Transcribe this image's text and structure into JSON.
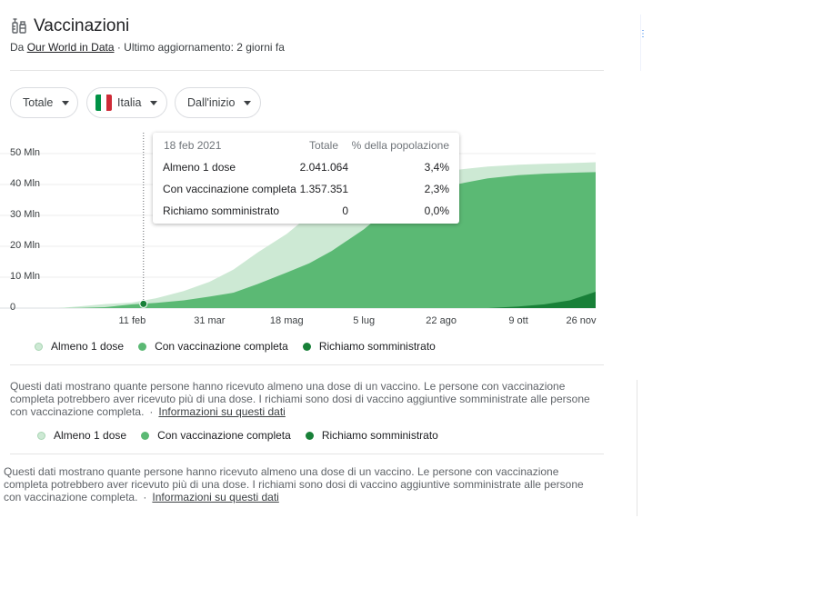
{
  "header": {
    "title": "Vaccinazioni",
    "source_prefix": "Da",
    "source_link": "Our World in Data",
    "source_suffix": "· Ultimo aggiornamento: 2 giorni fa"
  },
  "filters": {
    "metric": "Totale",
    "country": "Italia",
    "range": "Dall'inizio"
  },
  "colors": {
    "at_least_one": "#cde9d4",
    "fully": "#5bb974",
    "booster": "#188038",
    "flag_green": "#009246",
    "flag_white": "#ffffff",
    "flag_red": "#ce2b37"
  },
  "chart_data": {
    "type": "area",
    "title": "",
    "xlabel": "",
    "ylabel": "",
    "ylim": [
      0,
      50000000
    ],
    "yticks": [
      "0",
      "10 Mln",
      "20 Mln",
      "30 Mln",
      "40 Mln",
      "50 Mln"
    ],
    "xticks": [
      "11 feb",
      "31 mar",
      "18 mag",
      "5 lug",
      "22 ago",
      "9 ott",
      "26 nov"
    ],
    "grid": true,
    "legend_position": "bottom",
    "x": [
      "2020-12-27",
      "2021-01-10",
      "2021-01-25",
      "2021-02-11",
      "2021-02-26",
      "2021-03-15",
      "2021-03-31",
      "2021-04-15",
      "2021-04-30",
      "2021-05-18",
      "2021-06-01",
      "2021-06-15",
      "2021-07-05",
      "2021-07-20",
      "2021-08-05",
      "2021-08-22",
      "2021-09-05",
      "2021-09-20",
      "2021-10-09",
      "2021-10-25",
      "2021-11-10",
      "2021-11-26"
    ],
    "series": [
      {
        "name": "Almeno 1 dose",
        "values": [
          0,
          600000,
          1300000,
          1800000,
          3200000,
          5500000,
          8500000,
          12500000,
          18000000,
          24000000,
          30000000,
          35500000,
          40000000,
          41000000,
          42500000,
          44000000,
          45000000,
          45800000,
          46400000,
          46700000,
          46900000,
          47200000
        ]
      },
      {
        "name": "Con vaccinazione completa",
        "values": [
          0,
          50000,
          300000,
          1200000,
          1700000,
          2500000,
          3700000,
          5000000,
          7800000,
          11500000,
          14500000,
          18500000,
          25500000,
          32000000,
          36500000,
          39000000,
          40500000,
          42000000,
          43000000,
          43500000,
          43800000,
          44000000
        ]
      },
      {
        "name": "Richiamo somministrato",
        "values": [
          0,
          0,
          0,
          0,
          0,
          0,
          0,
          0,
          0,
          0,
          0,
          0,
          0,
          0,
          0,
          0,
          0,
          0,
          500000,
          1200000,
          2500000,
          5300000
        ]
      }
    ],
    "highlight": {
      "date": "18 feb 2021",
      "col_total": "Totale",
      "col_pct": "% della popolazione",
      "rows": [
        {
          "label": "Almeno 1 dose",
          "total": "2.041.064",
          "pct": "3,4%"
        },
        {
          "label": "Con vaccinazione completa",
          "total": "1.357.351",
          "pct": "2,3%"
        },
        {
          "label": "Richiamo somministrato",
          "total": "0",
          "pct": "0,0%"
        }
      ]
    }
  },
  "legend": [
    {
      "label": "Almeno 1 dose"
    },
    {
      "label": "Con vaccinazione completa"
    },
    {
      "label": "Richiamo somministrato"
    }
  ],
  "description": {
    "text": "Questi dati mostrano quante persone hanno ricevuto almeno una dose di un vaccino. Le persone con vaccinazione completa potrebbero aver ricevuto più di una dose. I richiami sono dosi di vaccino aggiuntive somministrate alle persone con vaccinazione completa.",
    "separator": "·",
    "link": "Informazioni su questi dati"
  }
}
